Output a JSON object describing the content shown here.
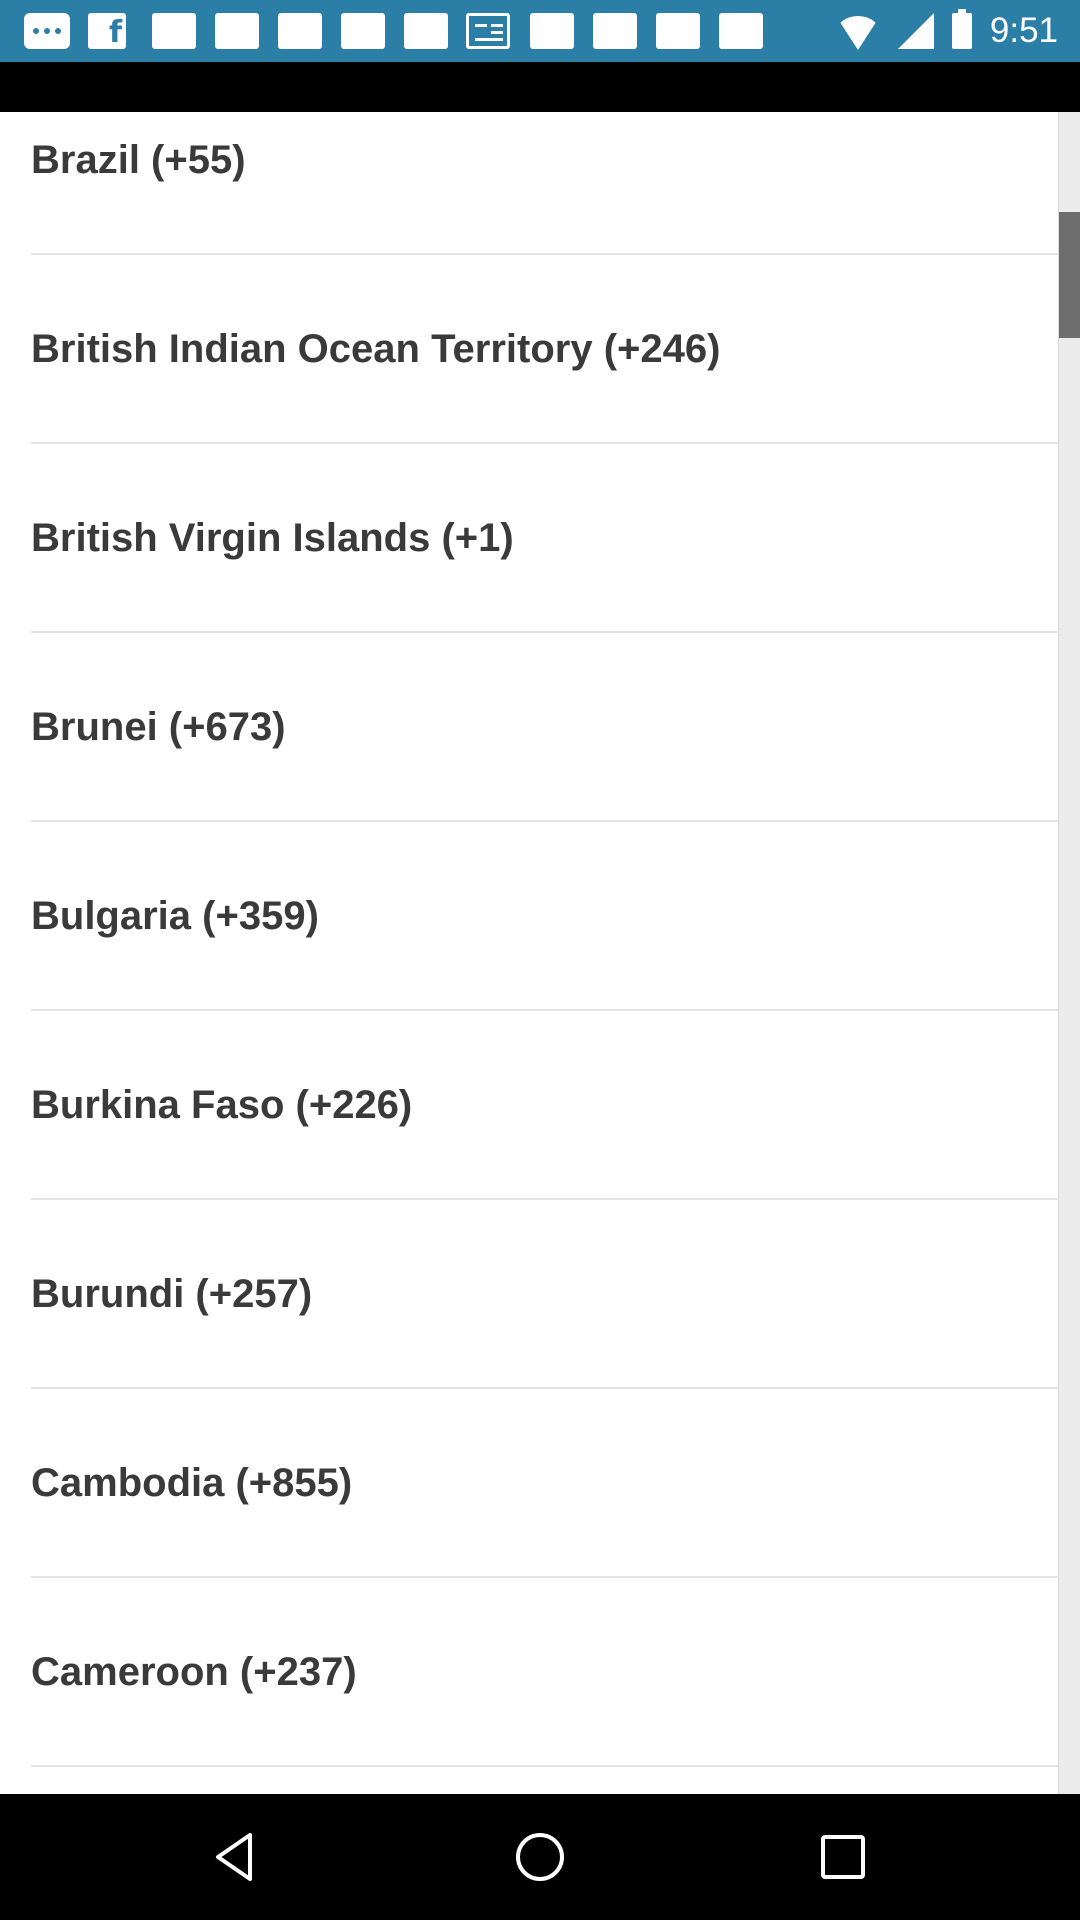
{
  "status_bar": {
    "time": "9:51",
    "color": "#2b7fa6",
    "icons": [
      "more-icon",
      "facebook-icon",
      "notification-icon",
      "notification-icon",
      "notification-icon",
      "notification-icon",
      "news-icon",
      "notification-icon",
      "notification-icon",
      "notification-icon",
      "notification-icon",
      "wifi-icon",
      "signal-icon",
      "battery-icon"
    ]
  },
  "country_list": {
    "items": [
      {
        "label": "Brazil (+55)"
      },
      {
        "label": "British Indian Ocean Territory (+246)"
      },
      {
        "label": "British Virgin Islands (+1)"
      },
      {
        "label": "Brunei (+673)"
      },
      {
        "label": "Bulgaria (+359)"
      },
      {
        "label": "Burkina Faso (+226)"
      },
      {
        "label": "Burundi (+257)"
      },
      {
        "label": "Cambodia (+855)"
      },
      {
        "label": "Cameroon (+237)"
      }
    ],
    "text_color": "#3a3a3a",
    "divider_color": "#e4e4e4"
  },
  "navigation_bar": {
    "icons": [
      "back-icon",
      "home-icon",
      "recents-icon"
    ]
  }
}
